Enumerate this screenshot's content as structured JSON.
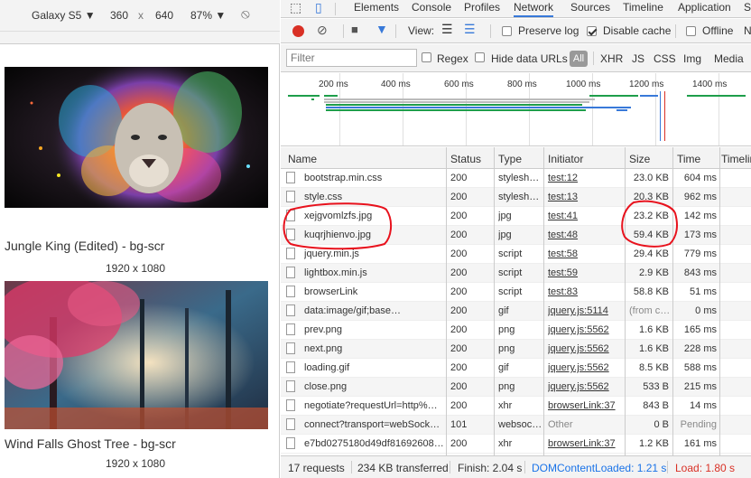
{
  "device": {
    "name": "Galaxy S5",
    "width": "360",
    "x": "x",
    "height": "640",
    "zoom": "87%"
  },
  "gallery": [
    {
      "title": "Jungle King (Edited) - bg-scr",
      "dims": "1920 x 1080"
    },
    {
      "title": "Wind Falls Ghost Tree - bg-scr",
      "dims": "1920 x 1080"
    }
  ],
  "tabs": [
    "Elements",
    "Console",
    "Profiles",
    "Network",
    "Sources",
    "Timeline",
    "Application",
    "S"
  ],
  "toolbar": {
    "view_label": "View:",
    "preserve_log": "Preserve log",
    "disable_cache": "Disable cache",
    "offline": "Offline",
    "extra": "N"
  },
  "filter": {
    "placeholder": "Filter",
    "regex": "Regex",
    "hide_data_urls": "Hide data URLs",
    "all": "All",
    "types": [
      "XHR",
      "JS",
      "CSS",
      "Img",
      "Media"
    ]
  },
  "overview_ticks": [
    "200 ms",
    "400 ms",
    "600 ms",
    "800 ms",
    "1000 ms",
    "1200 ms",
    "1400 ms"
  ],
  "columns": [
    "Name",
    "Status",
    "Type",
    "Initiator",
    "Size",
    "Time",
    "Timeline"
  ],
  "rows": [
    {
      "name": "bootstrap.min.css",
      "status": "200",
      "type": "stylesh…",
      "initiator": "test:12",
      "size": "23.0 KB",
      "time": "604 ms"
    },
    {
      "name": "style.css",
      "status": "200",
      "type": "stylesh…",
      "initiator": "test:13",
      "size": "20.3 KB",
      "time": "962 ms"
    },
    {
      "name": "xejgvomlzfs.jpg",
      "status": "200",
      "type": "jpg",
      "initiator": "test:41",
      "size": "23.2 KB",
      "time": "142 ms"
    },
    {
      "name": "kuqrjhienvo.jpg",
      "status": "200",
      "type": "jpg",
      "initiator": "test:48",
      "size": "59.4 KB",
      "time": "173 ms"
    },
    {
      "name": "jquery.min.js",
      "status": "200",
      "type": "script",
      "initiator": "test:58",
      "size": "29.4 KB",
      "time": "779 ms"
    },
    {
      "name": "lightbox.min.js",
      "status": "200",
      "type": "script",
      "initiator": "test:59",
      "size": "2.9 KB",
      "time": "843 ms"
    },
    {
      "name": "browserLink",
      "status": "200",
      "type": "script",
      "initiator": "test:83",
      "size": "58.8 KB",
      "time": "51 ms"
    },
    {
      "name": "data:image/gif;base…",
      "status": "200",
      "type": "gif",
      "initiator": "jquery.js:5114",
      "size": "(from c…",
      "time": "0 ms"
    },
    {
      "name": "prev.png",
      "status": "200",
      "type": "png",
      "initiator": "jquery.js:5562",
      "size": "1.6 KB",
      "time": "165 ms"
    },
    {
      "name": "next.png",
      "status": "200",
      "type": "png",
      "initiator": "jquery.js:5562",
      "size": "1.6 KB",
      "time": "228 ms"
    },
    {
      "name": "loading.gif",
      "status": "200",
      "type": "gif",
      "initiator": "jquery.js:5562",
      "size": "8.5 KB",
      "time": "588 ms"
    },
    {
      "name": "close.png",
      "status": "200",
      "type": "png",
      "initiator": "jquery.js:5562",
      "size": "533 B",
      "time": "215 ms"
    },
    {
      "name": "negotiate?requestUrl=http%…",
      "status": "200",
      "type": "xhr",
      "initiator": "browserLink:37",
      "size": "843 B",
      "time": "14 ms"
    },
    {
      "name": "connect?transport=webSock…",
      "status": "101",
      "type": "websoc…",
      "initiator": "Other",
      "size": "0 B",
      "time": "Pending"
    },
    {
      "name": "e7bd0275180d49df81692608…",
      "status": "200",
      "type": "xhr",
      "initiator": "browserLink:37",
      "size": "1.2 KB",
      "time": "161 ms"
    }
  ],
  "status_bar": {
    "requests": "17 requests",
    "transferred": "234 KB transferred",
    "finish": "Finish: 2.04 s",
    "dcl": "DOMContentLoaded: 1.21 s",
    "load": "Load: 1.80 s"
  },
  "colors": {
    "accent": "#3879d9",
    "record": "#d93025",
    "dcl": "#1a73e8",
    "load": "#d93025",
    "annotation": "#e8121d"
  }
}
